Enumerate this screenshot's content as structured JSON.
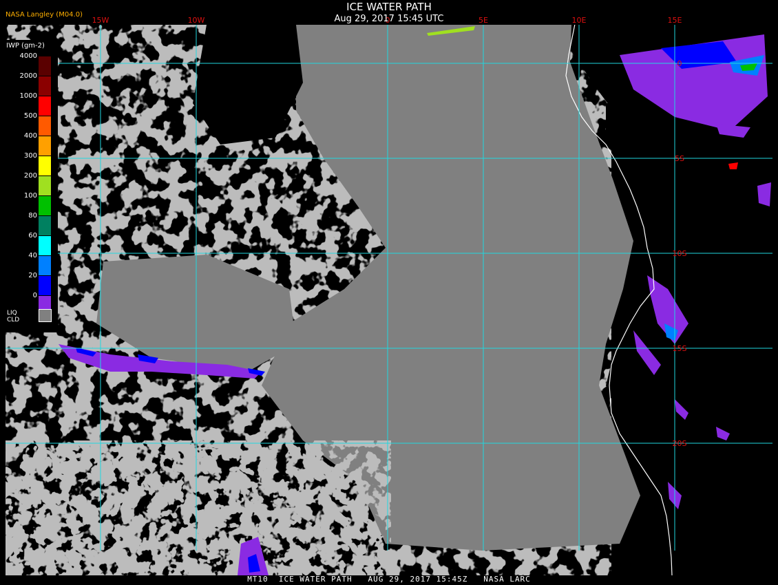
{
  "header": {
    "title": "ICE WATER PATH",
    "subtitle": "Aug 29, 2017 15:45 UTC",
    "provider": "NASA Langley (M04.0)"
  },
  "footer": {
    "text": "MT10  ICE WATER PATH   AUG 29, 2017 15:45Z   NASA LARC"
  },
  "legend": {
    "title": "IWP (gm-2)",
    "levels": [
      {
        "label": "4000",
        "color": "#5a0000"
      },
      {
        "label": "2000",
        "color": "#8b0000"
      },
      {
        "label": "1000",
        "color": "#ff0000"
      },
      {
        "label": "500",
        "color": "#ff5a00"
      },
      {
        "label": "400",
        "color": "#ffa000"
      },
      {
        "label": "300",
        "color": "#ffff00"
      },
      {
        "label": "200",
        "color": "#a0e020"
      },
      {
        "label": "100",
        "color": "#00c000"
      },
      {
        "label": "80",
        "color": "#008060"
      },
      {
        "label": "60",
        "color": "#00ffff"
      },
      {
        "label": "40",
        "color": "#0080ff"
      },
      {
        "label": "20",
        "color": "#0000ff"
      },
      {
        "label": "0",
        "color": "#8a2be2"
      }
    ],
    "liq_label_1": "LIQ",
    "liq_label_2": "CLD",
    "liq_color": "#808080"
  },
  "grid": {
    "longitudes": [
      {
        "label": "15W",
        "value": -15
      },
      {
        "label": "10W",
        "value": -10
      },
      {
        "label": "0",
        "value": 0
      },
      {
        "label": "5E",
        "value": 5
      },
      {
        "label": "10E",
        "value": 10
      },
      {
        "label": "15E",
        "value": 15
      }
    ],
    "latitudes": [
      {
        "label": "0",
        "value": 0
      },
      {
        "label": "5S",
        "value": -5
      },
      {
        "label": "10S",
        "value": -10
      },
      {
        "label": "15S",
        "value": -15
      },
      {
        "label": "20S",
        "value": -20
      }
    ],
    "line_color": "#20d8e0",
    "label_color": "#e01010"
  },
  "colors": {
    "clear": "#000000",
    "liquid_cloud": "#808080",
    "coastline": "#ffffff",
    "ice_low": "#8a2be2",
    "ice_mid": "#0000ff"
  }
}
